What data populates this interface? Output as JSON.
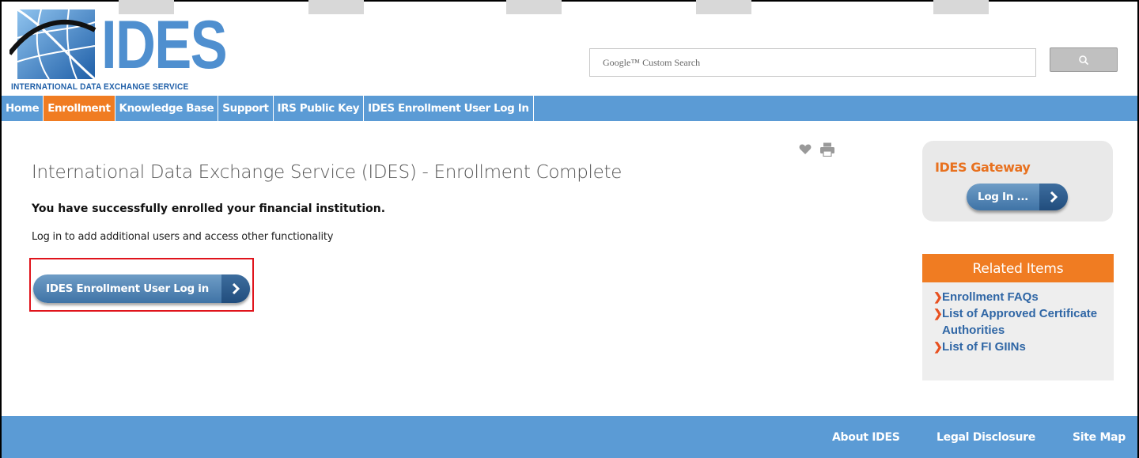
{
  "header": {
    "logo_text": "IDES",
    "logo_subtitle": "INTERNATIONAL DATA EXCHANGE SERVICE",
    "search_placeholder": "Google™ Custom Search",
    "search_icon": "search-icon"
  },
  "nav": {
    "items": [
      {
        "label": "Home",
        "active": false
      },
      {
        "label": "Enrollment",
        "active": true
      },
      {
        "label": "Knowledge Base",
        "active": false
      },
      {
        "label": "Support",
        "active": false
      },
      {
        "label": "IRS Public Key",
        "active": false
      },
      {
        "label": "IDES Enrollment User Log In",
        "active": false
      }
    ]
  },
  "main": {
    "title": "International Data Exchange Service (IDES) - Enrollment Complete",
    "success_message": "You have successfully enrolled your financial institution.",
    "login_message": "Log in to add additional users and access other functionality",
    "login_button_label": "IDES Enrollment User Log in",
    "icons": [
      "heart-icon",
      "print-icon"
    ]
  },
  "sidebar": {
    "gateway_title": "IDES Gateway",
    "gateway_button_label": "Log In ...",
    "related_title": "Related Items",
    "related_items": [
      "Enrollment FAQs",
      "List of Approved Certificate Authorities",
      "List of FI GIINs"
    ]
  },
  "footer": {
    "links": [
      "About IDES",
      "Legal Disclosure",
      "Site Map"
    ]
  },
  "colors": {
    "nav_blue": "#5b9bd5",
    "accent_orange": "#f07c22",
    "link_blue": "#2f66a5",
    "highlight_red": "#e0141c"
  }
}
